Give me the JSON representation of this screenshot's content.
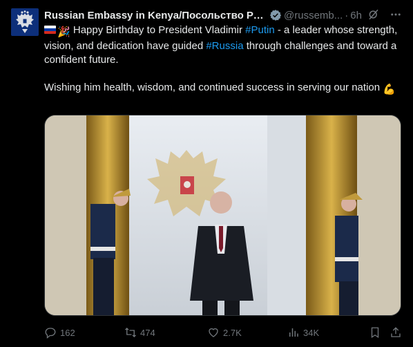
{
  "author": {
    "name": "Russian Embassy in Kenya/Посольство Ро...",
    "handle": "@russemb...",
    "separator": "·",
    "time": "6h",
    "avatar_icon": "double-headed-eagle-emblem",
    "verified_icon": "verified-badge-icon"
  },
  "tweet": {
    "line1_pre": "Happy Birthday to President Vladimir",
    "hashtag1": "#Putin",
    "line1_post": "- a leader whose strength, vision, and dedication have guided",
    "hashtag2": "#Russia",
    "line1_end": "through challenges and toward a confident future.",
    "line2": "Wishing him health, wisdom, and continued success in serving our nation",
    "emoji_lead": "🎉",
    "emoji_end": "💪"
  },
  "actions": {
    "replies": "162",
    "reposts": "474",
    "likes": "2.7K",
    "views": "34K"
  },
  "colors": {
    "background": "#000000",
    "text": "#e7e9ea",
    "muted": "#71767b",
    "accent": "#1d9bf0",
    "border": "#2f3336"
  }
}
